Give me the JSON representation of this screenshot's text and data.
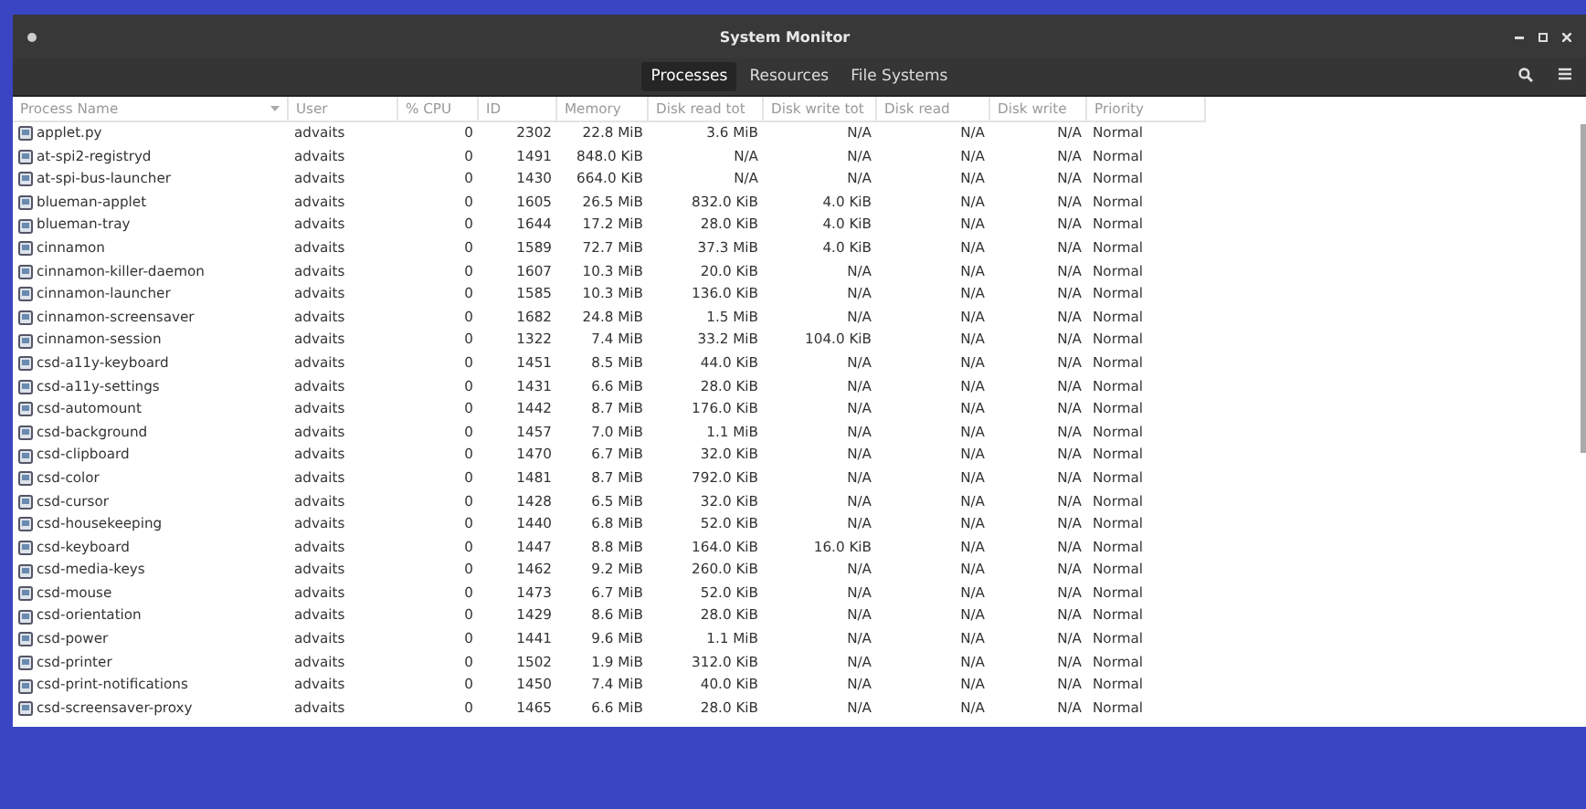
{
  "window": {
    "title": "System Monitor"
  },
  "tabs": [
    {
      "label": "Processes",
      "selected": true
    },
    {
      "label": "Resources",
      "selected": false
    },
    {
      "label": "File Systems",
      "selected": false
    }
  ],
  "table": {
    "columns": [
      "Process Name",
      "User",
      "% CPU",
      "ID",
      "Memory",
      "Disk read tot",
      "Disk write tot",
      "Disk read",
      "Disk write",
      "Priority"
    ],
    "rows": [
      [
        "applet.py",
        "advaits",
        "0",
        "2302",
        "22.8 MiB",
        "3.6 MiB",
        "N/A",
        "N/A",
        "N/A",
        "Normal"
      ],
      [
        "at-spi2-registryd",
        "advaits",
        "0",
        "1491",
        "848.0 KiB",
        "N/A",
        "N/A",
        "N/A",
        "N/A",
        "Normal"
      ],
      [
        "at-spi-bus-launcher",
        "advaits",
        "0",
        "1430",
        "664.0 KiB",
        "N/A",
        "N/A",
        "N/A",
        "N/A",
        "Normal"
      ],
      [
        "blueman-applet",
        "advaits",
        "0",
        "1605",
        "26.5 MiB",
        "832.0 KiB",
        "4.0 KiB",
        "N/A",
        "N/A",
        "Normal"
      ],
      [
        "blueman-tray",
        "advaits",
        "0",
        "1644",
        "17.2 MiB",
        "28.0 KiB",
        "4.0 KiB",
        "N/A",
        "N/A",
        "Normal"
      ],
      [
        "cinnamon",
        "advaits",
        "0",
        "1589",
        "72.7 MiB",
        "37.3 MiB",
        "4.0 KiB",
        "N/A",
        "N/A",
        "Normal"
      ],
      [
        "cinnamon-killer-daemon",
        "advaits",
        "0",
        "1607",
        "10.3 MiB",
        "20.0 KiB",
        "N/A",
        "N/A",
        "N/A",
        "Normal"
      ],
      [
        "cinnamon-launcher",
        "advaits",
        "0",
        "1585",
        "10.3 MiB",
        "136.0 KiB",
        "N/A",
        "N/A",
        "N/A",
        "Normal"
      ],
      [
        "cinnamon-screensaver",
        "advaits",
        "0",
        "1682",
        "24.8 MiB",
        "1.5 MiB",
        "N/A",
        "N/A",
        "N/A",
        "Normal"
      ],
      [
        "cinnamon-session",
        "advaits",
        "0",
        "1322",
        "7.4 MiB",
        "33.2 MiB",
        "104.0 KiB",
        "N/A",
        "N/A",
        "Normal"
      ],
      [
        "csd-a11y-keyboard",
        "advaits",
        "0",
        "1451",
        "8.5 MiB",
        "44.0 KiB",
        "N/A",
        "N/A",
        "N/A",
        "Normal"
      ],
      [
        "csd-a11y-settings",
        "advaits",
        "0",
        "1431",
        "6.6 MiB",
        "28.0 KiB",
        "N/A",
        "N/A",
        "N/A",
        "Normal"
      ],
      [
        "csd-automount",
        "advaits",
        "0",
        "1442",
        "8.7 MiB",
        "176.0 KiB",
        "N/A",
        "N/A",
        "N/A",
        "Normal"
      ],
      [
        "csd-background",
        "advaits",
        "0",
        "1457",
        "7.0 MiB",
        "1.1 MiB",
        "N/A",
        "N/A",
        "N/A",
        "Normal"
      ],
      [
        "csd-clipboard",
        "advaits",
        "0",
        "1470",
        "6.7 MiB",
        "32.0 KiB",
        "N/A",
        "N/A",
        "N/A",
        "Normal"
      ],
      [
        "csd-color",
        "advaits",
        "0",
        "1481",
        "8.7 MiB",
        "792.0 KiB",
        "N/A",
        "N/A",
        "N/A",
        "Normal"
      ],
      [
        "csd-cursor",
        "advaits",
        "0",
        "1428",
        "6.5 MiB",
        "32.0 KiB",
        "N/A",
        "N/A",
        "N/A",
        "Normal"
      ],
      [
        "csd-housekeeping",
        "advaits",
        "0",
        "1440",
        "6.8 MiB",
        "52.0 KiB",
        "N/A",
        "N/A",
        "N/A",
        "Normal"
      ],
      [
        "csd-keyboard",
        "advaits",
        "0",
        "1447",
        "8.8 MiB",
        "164.0 KiB",
        "16.0 KiB",
        "N/A",
        "N/A",
        "Normal"
      ],
      [
        "csd-media-keys",
        "advaits",
        "0",
        "1462",
        "9.2 MiB",
        "260.0 KiB",
        "N/A",
        "N/A",
        "N/A",
        "Normal"
      ],
      [
        "csd-mouse",
        "advaits",
        "0",
        "1473",
        "6.7 MiB",
        "52.0 KiB",
        "N/A",
        "N/A",
        "N/A",
        "Normal"
      ],
      [
        "csd-orientation",
        "advaits",
        "0",
        "1429",
        "8.6 MiB",
        "28.0 KiB",
        "N/A",
        "N/A",
        "N/A",
        "Normal"
      ],
      [
        "csd-power",
        "advaits",
        "0",
        "1441",
        "9.6 MiB",
        "1.1 MiB",
        "N/A",
        "N/A",
        "N/A",
        "Normal"
      ],
      [
        "csd-printer",
        "advaits",
        "0",
        "1502",
        "1.9 MiB",
        "312.0 KiB",
        "N/A",
        "N/A",
        "N/A",
        "Normal"
      ],
      [
        "csd-print-notifications",
        "advaits",
        "0",
        "1450",
        "7.4 MiB",
        "40.0 KiB",
        "N/A",
        "N/A",
        "N/A",
        "Normal"
      ],
      [
        "csd-screensaver-proxy",
        "advaits",
        "0",
        "1465",
        "6.6 MiB",
        "28.0 KiB",
        "N/A",
        "N/A",
        "N/A",
        "Normal"
      ]
    ]
  }
}
